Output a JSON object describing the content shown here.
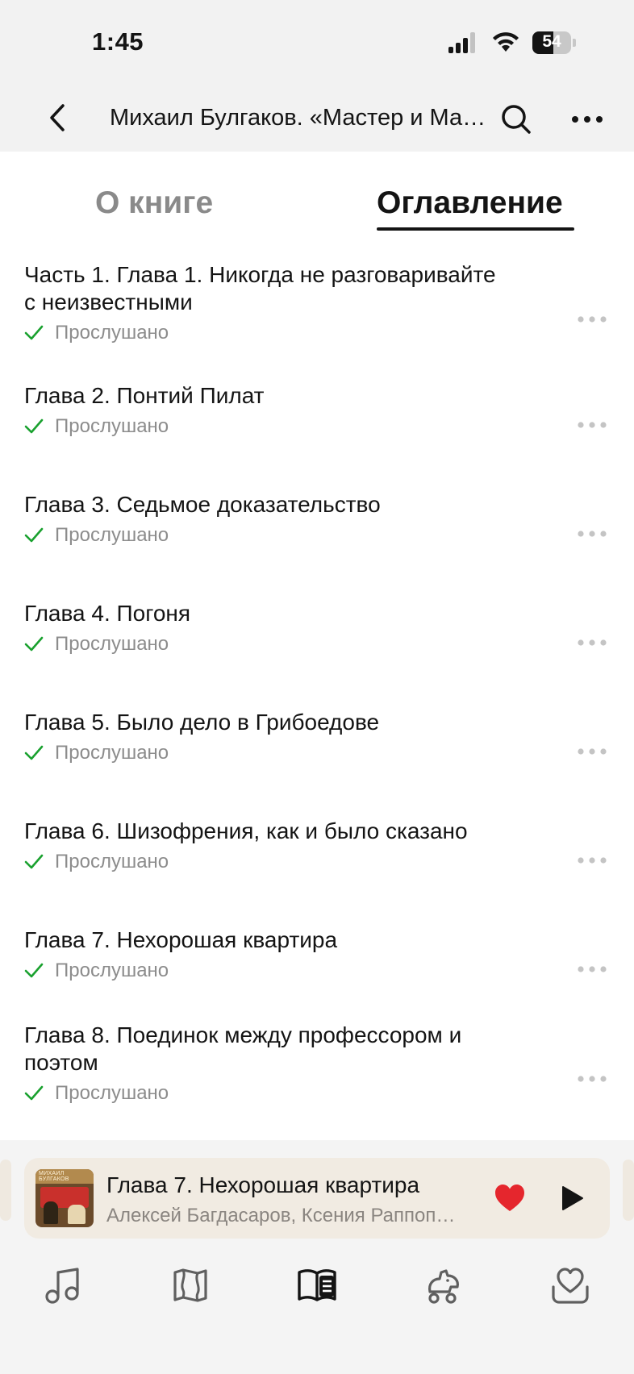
{
  "status_bar": {
    "time": "1:45",
    "battery": "54",
    "battery_level": 0.54
  },
  "header": {
    "title": "Михаил Булгаков. «Мастер и Маргарита»"
  },
  "tabs": [
    {
      "label": "О книге",
      "active": false
    },
    {
      "label": "Оглавление",
      "active": true
    }
  ],
  "chapters": [
    {
      "title": "Часть 1. Глава 1. Никогда не разговаривайте с неизвестными",
      "status": "Прослушано"
    },
    {
      "title": "Глава 2. Понтий Пилат",
      "status": "Прослушано"
    },
    {
      "title": "Глава 3. Седьмое доказательство",
      "status": "Прослушано"
    },
    {
      "title": "Глава 4. Погоня",
      "status": "Прослушано"
    },
    {
      "title": "Глава 5. Было дело в Грибоедове",
      "status": "Прослушано"
    },
    {
      "title": "Глава 6. Шизофрения, как и было сказано",
      "status": "Прослушано"
    },
    {
      "title": "Глава 7. Нехорошая квартира",
      "status": "Прослушано"
    },
    {
      "title": "Глава 8. Поединок между профессором и поэтом",
      "status": "Прослушано"
    }
  ],
  "player": {
    "title": "Глава 7. Нехорошая квартира",
    "subtitle": "Алексей Багдасаров, Ксения Раппопорт",
    "cover_text": "МИХАИЛ БУЛГАКОВ",
    "liked": true
  },
  "tabbar": [
    {
      "icon": "music-note-icon"
    },
    {
      "icon": "map-icon"
    },
    {
      "icon": "book-icon",
      "active": true
    },
    {
      "icon": "kids-horse-icon"
    },
    {
      "icon": "heart-collection-icon"
    }
  ],
  "colors": {
    "check": "#1aa12f",
    "heart": "#e5262d",
    "muted": "#8c8c8c"
  }
}
